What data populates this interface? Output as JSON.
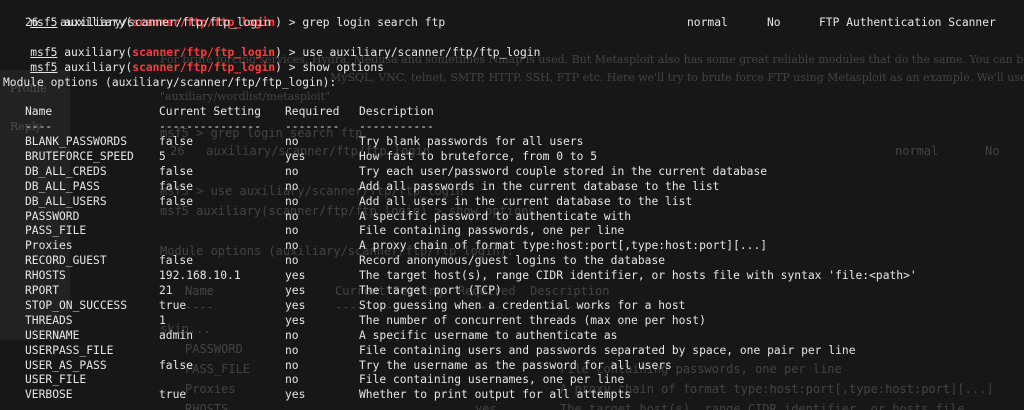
{
  "prompt": {
    "label": "msf5",
    "module_prefix": "auxiliary(",
    "module": "scanner/ftp/ftp_login",
    "module_suffix": ")",
    "symbol": ">"
  },
  "commands": [
    "grep login search ftp",
    "use auxiliary/scanner/ftp/ftp_login",
    "show options"
  ],
  "search_result": {
    "index": "26",
    "name": "auxiliary/scanner/ftp/ftp_login",
    "rank": "normal",
    "check": "No",
    "description": "FTP Authentication Scanner"
  },
  "module_options_header": "Module options (auxiliary/scanner/ftp/ftp_login):",
  "columns": {
    "name": "Name",
    "setting": "Current Setting",
    "required": "Required",
    "description": "Description"
  },
  "underlines": {
    "name": "----",
    "setting": "---------------",
    "required": "--------",
    "description": "-----------"
  },
  "options": [
    {
      "name": "BLANK_PASSWORDS",
      "setting": "false",
      "required": "no",
      "description": "Try blank passwords for all users"
    },
    {
      "name": "BRUTEFORCE_SPEED",
      "setting": "5",
      "required": "yes",
      "description": "How fast to bruteforce, from 0 to 5"
    },
    {
      "name": "DB_ALL_CREDS",
      "setting": "false",
      "required": "no",
      "description": "Try each user/password couple stored in the current database"
    },
    {
      "name": "DB_ALL_PASS",
      "setting": "false",
      "required": "no",
      "description": "Add all passwords in the current database to the list"
    },
    {
      "name": "DB_ALL_USERS",
      "setting": "false",
      "required": "no",
      "description": "Add all users in the current database to the list"
    },
    {
      "name": "PASSWORD",
      "setting": "",
      "required": "no",
      "description": "A specific password to authenticate with"
    },
    {
      "name": "PASS_FILE",
      "setting": "",
      "required": "no",
      "description": "File containing passwords, one per line"
    },
    {
      "name": "Proxies",
      "setting": "",
      "required": "no",
      "description": "A proxy chain of format type:host:port[,type:host:port][...]"
    },
    {
      "name": "RECORD_GUEST",
      "setting": "false",
      "required": "no",
      "description": "Record anonymous/guest logins to the database"
    },
    {
      "name": "RHOSTS",
      "setting": "192.168.10.1",
      "required": "yes",
      "description": "The target host(s), range CIDR identifier, or hosts file with syntax 'file:<path>'"
    },
    {
      "name": "RPORT",
      "setting": "21",
      "required": "yes",
      "description": "The target port (TCP)"
    },
    {
      "name": "STOP_ON_SUCCESS",
      "setting": "true",
      "required": "yes",
      "description": "Stop guessing when a credential works for a host"
    },
    {
      "name": "THREADS",
      "setting": "1",
      "required": "yes",
      "description": "The number of concurrent threads (max one per host)"
    },
    {
      "name": "USERNAME",
      "setting": "admin",
      "required": "no",
      "description": "A specific username to authenticate as"
    },
    {
      "name": "USERPASS_FILE",
      "setting": "",
      "required": "no",
      "description": "File containing users and passwords separated by space, one pair per line"
    },
    {
      "name": "USER_AS_PASS",
      "setting": "false",
      "required": "no",
      "description": "Try the username as the password for all users"
    },
    {
      "name": "USER_FILE",
      "setting": "",
      "required": "no",
      "description": "File containing usernames, one per line"
    },
    {
      "name": "VERBOSE",
      "setting": "true",
      "required": "yes",
      "description": "Whether to print output for all attempts"
    }
  ],
  "background_window": {
    "sidebar": [
      "Profile",
      "Reply"
    ],
    "article_lines": [
      "For brute forcing services, Hydra, Medusa and sometimes Nmap is used. But Metasploit also has some great reliable modules that do the same. You can brute force a l",
      "MySQL, VNC, telnet, SMTP, HTTP, SSH, FTP etc. Here we'll try to brute force FTP using Metasploit as an example. We'll use",
      "\"auxiliary/wordlist/metasploit\""
    ],
    "mirror_lines": [
      "msf5 > grep login search ftp",
      "26   auxiliary/scanner/ftp/ftp_login",
      "normal",
      "No",
      "msf5 > use auxiliary/scanner/ftp/ftp_login",
      "msf5 auxiliary(scanner/ftp/ftp_login) > show options",
      "Module options (auxiliary/scanner/ftp/ftp_login):",
      "Name",
      "Current Setting  Required  Description",
      "----",
      "---------------  --------  -----------",
      "skip...",
      "PASSWORD",
      "PASS_FILE",
      "File containing passwords, one per line",
      "Proxies",
      "A proxy chain of format type:host:port[,type:host:port][...]",
      "RHOSTS",
      "yes",
      "The target host(s), range CIDR identifier, or hosts file"
    ]
  }
}
